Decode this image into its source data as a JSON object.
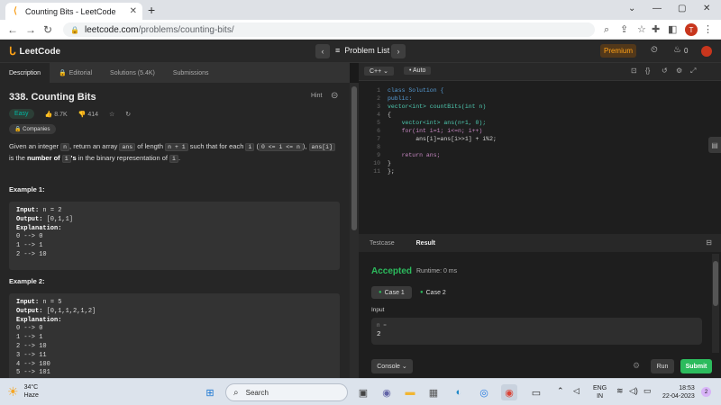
{
  "browser": {
    "tab_title": "Counting Bits - LeetCode",
    "url_host": "leetcode.com",
    "url_path": "/problems/counting-bits/",
    "profile_initial": "T"
  },
  "header": {
    "logo_text": "LeetCode",
    "problem_list": "Problem List",
    "premium": "Premium",
    "streak_count": "0"
  },
  "left": {
    "tabs": [
      "Description",
      "Editorial",
      "Solutions (5.4K)",
      "Submissions"
    ],
    "title": "338. Counting Bits",
    "hint": "Hint",
    "difficulty": "Easy",
    "likes": "8.7K",
    "dislikes": "414",
    "companies": "Companies",
    "desc": {
      "p1": "Given an integer ",
      "c1": "n",
      "p2": ", return an array ",
      "c2": "ans",
      "p3": " of length ",
      "c3": "n + 1",
      "p4": " such that for each ",
      "c4": "i",
      "p5": " (",
      "c5": "0 <= i <= n",
      "p6": "), ",
      "c6": "ans[i]",
      "p7": " is the ",
      "b1": "number of ",
      "c7": "1",
      "b2": "'s",
      "p8": " in the binary representation of ",
      "c8": "i",
      "p9": "."
    },
    "examples": [
      {
        "heading": "Example 1:",
        "input_label": "Input:",
        "input": " n = 2",
        "output_label": "Output:",
        "output": " [0,1,1]",
        "explanation_label": "Explanation:",
        "lines": [
          "0 --> 0",
          "1 --> 1",
          "2 --> 10"
        ]
      },
      {
        "heading": "Example 2:",
        "input_label": "Input:",
        "input": " n = 5",
        "output_label": "Output:",
        "output": " [0,1,1,2,1,2]",
        "explanation_label": "Explanation:",
        "lines": [
          "0 --> 0",
          "1 --> 1",
          "2 --> 10",
          "3 --> 11",
          "4 --> 100",
          "5 --> 101"
        ]
      }
    ]
  },
  "editor": {
    "language": "C++",
    "auto": "Auto",
    "lines": [
      "class Solution {",
      "public:",
      "vector<int> countBits(int n)",
      "{",
      "    vector<int> ans(n+1, 0);",
      "    for(int i=1; i<=n; i++)",
      "        ans[i]=ans[i>>1] + i%2;",
      "",
      "    return ans;",
      "}",
      "};"
    ]
  },
  "result": {
    "tabs": [
      "Testcase",
      "Result"
    ],
    "status": "Accepted",
    "runtime": "Runtime: 0 ms",
    "cases": [
      "Case 1",
      "Case 2"
    ],
    "input_label": "Input",
    "input_key": "n =",
    "input_value": "2",
    "console": "Console",
    "run": "Run",
    "submit": "Submit"
  },
  "taskbar": {
    "temp": "34°C",
    "weather": "Haze",
    "search": "Search",
    "lang1": "ENG",
    "lang2": "IN",
    "time": "18:53",
    "date": "22-04-2023",
    "notif": "2"
  }
}
